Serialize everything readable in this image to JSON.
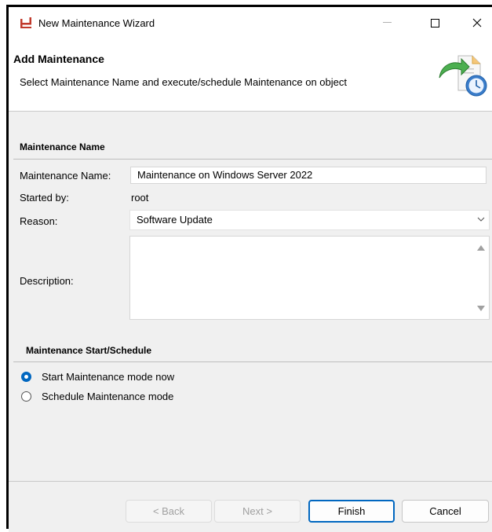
{
  "window": {
    "title": "New Maintenance Wizard"
  },
  "header": {
    "title": "Add Maintenance",
    "description": "Select Maintenance Name and execute/schedule Maintenance on object"
  },
  "maintenance_name_section": {
    "title": "Maintenance Name",
    "fields": {
      "name_label": "Maintenance Name:",
      "name_value": "Maintenance on Windows Server 2022",
      "started_by_label": "Started by:",
      "started_by_value": "root",
      "reason_label": "Reason:",
      "reason_value": "Software Update",
      "description_label": "Description:",
      "description_value": ""
    }
  },
  "schedule_section": {
    "title": "Maintenance Start/Schedule",
    "options": [
      {
        "label": "Start Maintenance mode now",
        "selected": true
      },
      {
        "label": "Schedule Maintenance mode",
        "selected": false
      }
    ]
  },
  "footer": {
    "back_label": "< Back",
    "next_label": "Next >",
    "finish_label": "Finish",
    "cancel_label": "Cancel"
  },
  "colors": {
    "accent": "#0067c0",
    "panel_bg": "#f0f0f0",
    "icon_red": "#c0392b",
    "arrow_green": "#4caf50",
    "clock_blue": "#3a7cc9"
  },
  "icons": {
    "app": "maintenance-app-icon",
    "header": "schedule-clock-icon"
  }
}
